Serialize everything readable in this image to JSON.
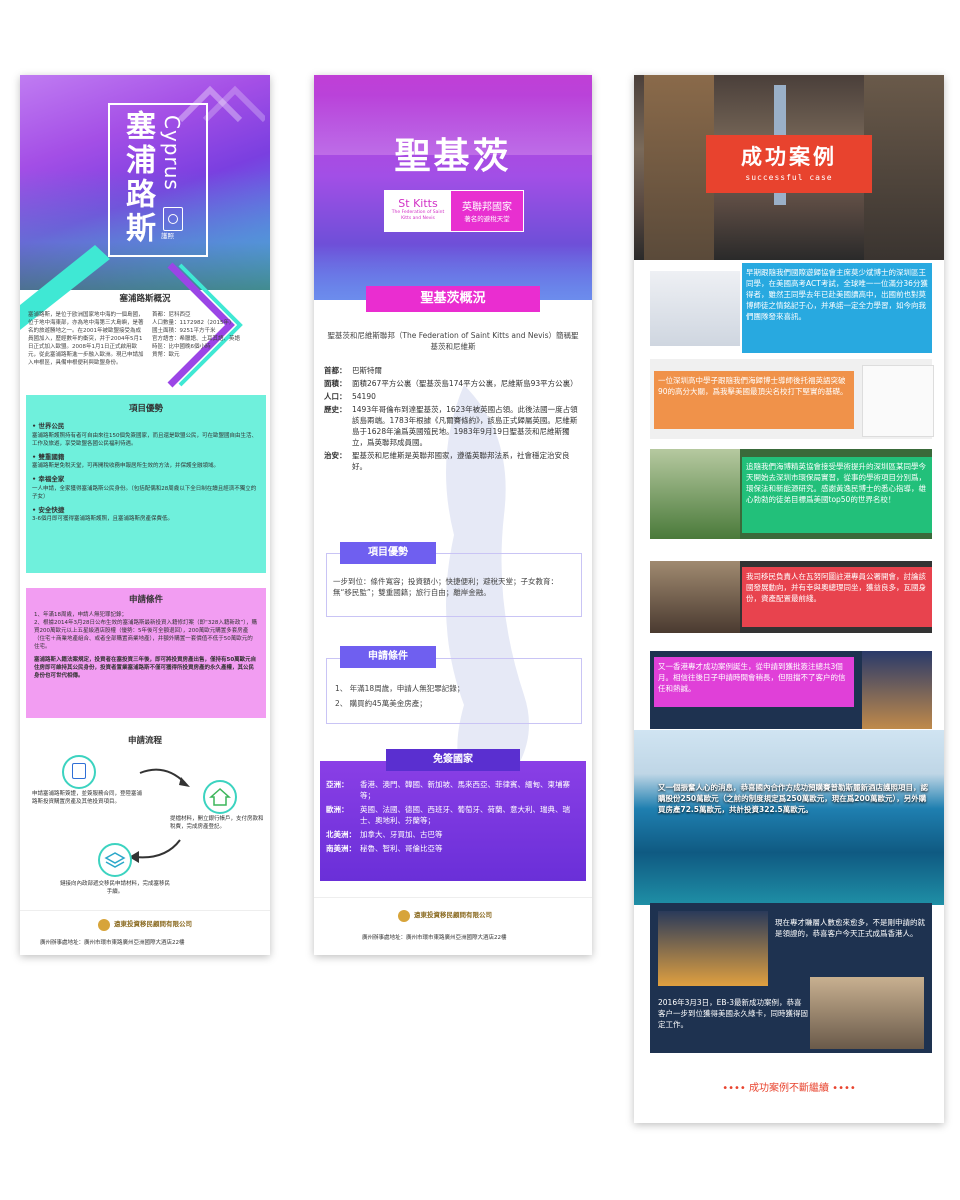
{
  "banner1": {
    "title_cn": "塞浦路斯",
    "title_en": "Cyprus",
    "passport_label": "護照",
    "overview_heading": "塞浦路斯概況",
    "overview_left": "塞浦路斯，是位于欧洲国家地中海的一個島國，位于地中海東部，亦為地中海第三大島嶼，是著名的旅遊勝地之一。在2001年被歐盟接受為成員國加入，歷經數年的衝突，并于2004年5月1日正式加入歐盟。2008年1月1日正式啟用歐元，從此塞浦路斯進一步融入歐洲。現已申請加入申根區，具備申根便利與歐盟身份。",
    "overview_right": "首都：尼科西亞\n人口數量：1172982（2015年）\n國土面積：9251平方千米\n官方語言：希臘語、土耳其語、英語\n時區：比中國晚6個小時\n貨幣：歐元",
    "advantages_heading": "項目優勢",
    "advantages": [
      {
        "title": "• 世界公民",
        "body": "塞浦路斯護照持有者可自由來往150個免簽國家，而且還是歐盟公民，可在歐盟國自由生活、工作及旅遊，享受歐盟各國公民福利待遇。"
      },
      {
        "title": "• 雙重國籍",
        "body": "塞浦路斯是免稅天堂，可再開稅收務申報居所生效的方法，并保護全融領域。"
      },
      {
        "title": "• 幸福全家",
        "body": "一人申請，全家獲得塞浦路斯公民身份。（包括配偶和28周歲以下全日制在讀且經濟不獨立的子女）"
      },
      {
        "title": "• 安全快捷",
        "body": "3-6個月即可獲得塞浦路斯護照，且塞浦路斯房產保費低。"
      }
    ],
    "conditions_heading": "申請條件",
    "conditions": "1、年滿18周歲，申請人無犯罪記錄；\n2、根據2014年3月28日公布生效的塞浦路斯最新投資入籍修訂案（即“328入籍新政”），購買200萬歐元以上五星級酒店股權（優勢：5年後可全額退回），200萬歐元購置多套房產（住宅＋商業地產組合、或者全部購置商業地產），并額外購置一套價值不低于50萬歐元的住宅。",
    "conditions_note": "塞浦路斯入籍法案規定，投資者在塞投資三年後，即可將投資房產出售，僅持有50萬歐元自住房即可維持其公民身份，投資者置業塞浦路斯不僅可獲得所投資房產的永久產權，其公民身份也可世代相傳。",
    "process_heading": "申請流程",
    "process_steps": [
      "申請塞浦路斯簽證，並簽服務合同，登陸塞浦路斯投資購置房產及其他投資項目。",
      "提檔材料，開立銀行帳戶，支付房款和稅費，完成房產登記。",
      "鏈接向內政部遞交移民申請材料，完成塞移民手續。"
    ],
    "company": "遠東投資移民顧問有限公司",
    "address": "廣州辦事處地址：廣州市環市東路廣州亞洲國際大酒店22樓"
  },
  "banner2": {
    "title": "聖基茨",
    "tag_en": "St Kitts",
    "tag_en_sub": "The Federation of Saint Kitts and Nevis",
    "tag_cn": "英聯邦國家",
    "tag_cn_sub": "著名的避稅天堂",
    "overview_heading": "聖基茨概況",
    "intro": "聖基茨和尼維斯聯邦（The Federation of Saint Kitts and Nevis）簡稱聖基茨和尼維斯",
    "facts": [
      {
        "k": "首都：",
        "v": "巴斯特爾"
      },
      {
        "k": "面積：",
        "v": "面積267平方公裏（聖基茨島174平方公裏，尼維斯島93平方公裏）"
      },
      {
        "k": "人口：",
        "v": "54190"
      },
      {
        "k": "歷史：",
        "v": "1493年哥倫布到達聖基茨，1623年被英國占領。此後法國一度占領該島兩端。1783年根據《凡爾賽條約》，該島正式歸屬英國。尼維斯島于1628年淪爲英國殖民地。1983年9月19日聖基茨和尼維斯獨立，爲英聯邦成員國。"
      },
      {
        "k": "治安：",
        "v": "聖基茨和尼維斯是英聯邦國家，遵循英聯邦法系，社會穩定治安良好。"
      }
    ],
    "adv_heading": "項目優勢",
    "adv_text": "一步到位：條件寬容；投資額小；快捷便利；避稅天堂；子女教育：無“移民監”；雙重國籍；旅行自由；離岸金融。",
    "cond_heading": "申請條件",
    "cond_items": [
      "1、  年滿18周歲，申請人無犯罪記錄；",
      "2、  購買約45萬美金房產；"
    ],
    "visa_heading": "免簽國家",
    "visa": [
      {
        "k": "亞洲：",
        "v": "香港、澳門、韓國、新加坡、馬來西亞、菲律賓、緬甸、柬埔寨等；"
      },
      {
        "k": "歐洲：",
        "v": "英國、法國、德國、西班牙、葡萄牙、荷蘭、意大利、瑞典、瑞士、奧地利、芬蘭等；"
      },
      {
        "k": "北美洲：",
        "v": "加拿大、牙買加、古巴等"
      },
      {
        "k": "南美洲：",
        "v": "秘魯、智利、哥倫比亞等"
      }
    ],
    "company": "遠東投資移民顧問有限公司",
    "address": "廣州辦事處地址：廣州市環市東路廣州亞洲國際大酒店22樓"
  },
  "banner3": {
    "title": "成功案例",
    "subtitle": "successful case",
    "cases": [
      "早期跟隨我們國際遊歸協會主席莫少斌博士的深圳區王同學，在美國高考ACT考試，全球唯一一位滿分36分獲得者，雖然王同學去年已赴美國讀高中，出國前也對莫博師徒之情銘記于心，并承諾一定全力學習，如今向我們團隊發來喜訊。",
      "一位深圳高中學子跟隨我們海歸博士導師後托福英語突破90的高分大關，爲我擊美國最頂尖名校打下堅實的基礎。",
      "追隨我們海博精英協會接受學術提升的深圳區某同學今天開始去深圳市環保局實習，從事的學術項目分別爲，環保法和新能源研究。感謝黃逸民博士的悉心指導，雄心勃勃的徒弟目標爲美國top50的世界名校！",
      "我司移民負責人在瓦努阿圖註港專員公署開會，討論該國發展動向，并有幸與奧總理同坐，獲益良多，瓦國身份，資產配置最前綫。",
      "又一香港專才成功案例誕生，從申請到獲批簽注總共3個月。相信往後日子申請時間會稍長，但阻擋不了客户的信任和熱誠。",
      "又一個振奮人心的消息，恭喜國內合作方成功預購賽普勒斯麗新酒店護照項目，認購股份250萬歐元（之前的制度規定爲250萬歐元，現在爲200萬歐元），另外購買房產72.5萬歐元，共計投資322.5萬歐元。",
      "現在專才賺層人數愈來愈多，不是剛申請的就是領證的，恭喜客户今天正式成爲香港人。",
      "2016年3月3日，EB-3最新成功案例，恭喜客户一步到位獲得美國永久綠卡，同時獲得固定工作。"
    ],
    "footer": "•••• 成功案例不斷繼續 ••••"
  },
  "colors": {
    "teal": "#6ff0dc",
    "pink": "#f29df2",
    "magenta": "#ea2dd0",
    "purple": "#6f5ff0",
    "orange": "#f0924a",
    "blue": "#28a9e0",
    "green": "#22c07a",
    "red": "#e8432e"
  }
}
